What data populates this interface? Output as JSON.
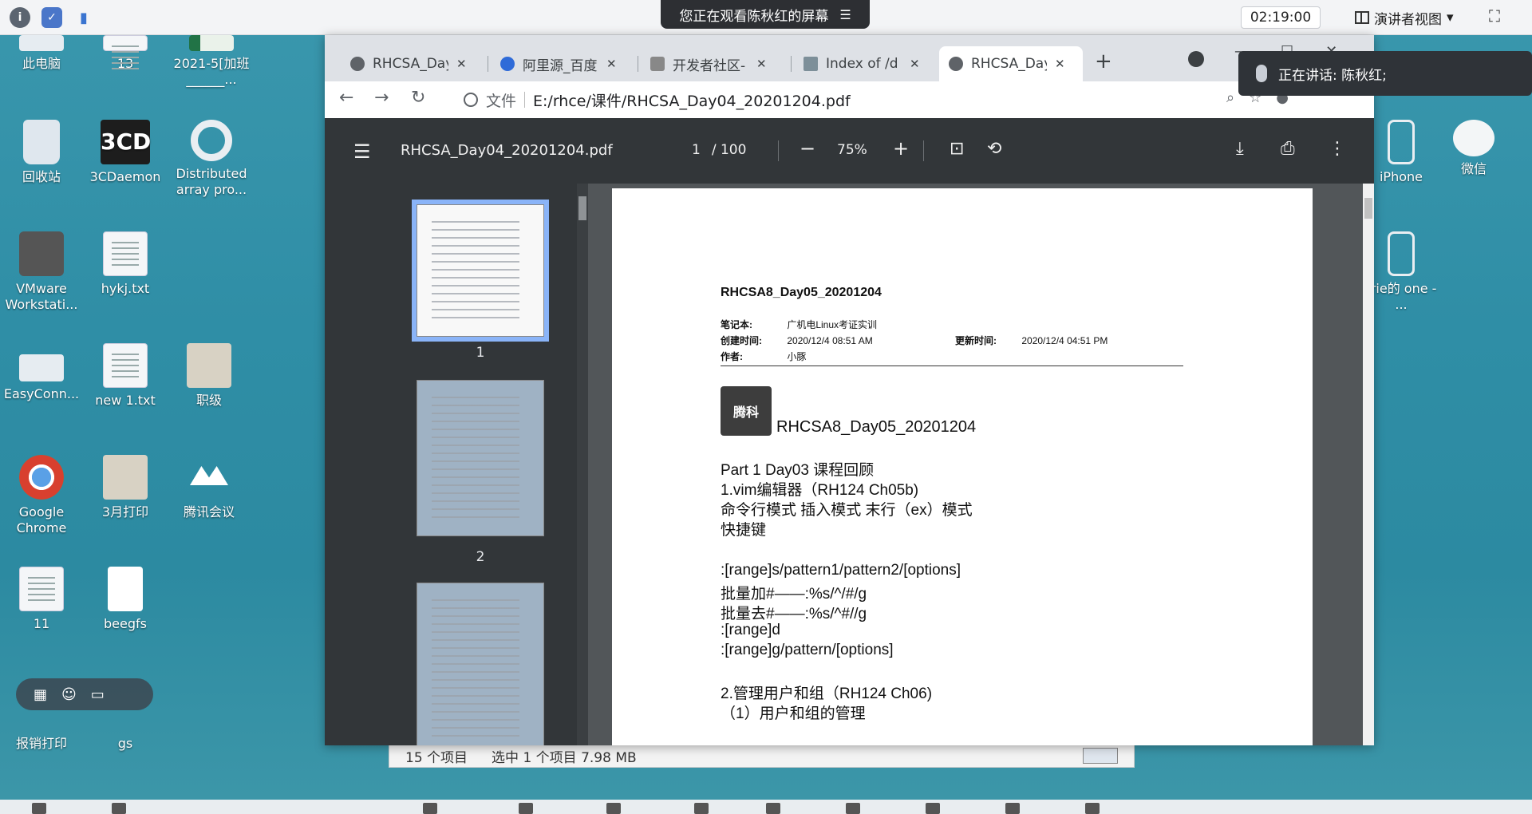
{
  "meeting": {
    "banner": "您正在观看陈秋红的屏幕",
    "time": "02:19:00",
    "view_label": "演讲者视图",
    "speaking": "正在讲话: 陈秋红;"
  },
  "desktop": {
    "icons": [
      {
        "label": "此电脑",
        "icon": "computer-icon"
      },
      {
        "label": "13",
        "icon": "document-icon"
      },
      {
        "label": "2021-5[加班______...",
        "icon": "excel-icon"
      },
      {
        "label": "回收站",
        "icon": "recycle-bin-icon"
      },
      {
        "label": "3CDaemon",
        "icon": "3cd-icon"
      },
      {
        "label": "Distributed array pro...",
        "icon": "ring-icon"
      },
      {
        "label": "VMware Workstati...",
        "icon": "vmware-icon"
      },
      {
        "label": "hykj.txt",
        "icon": "text-file-icon"
      },
      {
        "label": "EasyConn...",
        "icon": "easyconnect-icon"
      },
      {
        "label": "new 1.txt",
        "icon": "text-file-icon"
      },
      {
        "label": "职级",
        "icon": "zip-icon"
      },
      {
        "label": "Google Chrome",
        "icon": "chrome-icon"
      },
      {
        "label": "3月打印",
        "icon": "zip-icon"
      },
      {
        "label": "腾讯会议",
        "icon": "tencent-meeting-icon"
      },
      {
        "label": "11",
        "icon": "document-icon"
      },
      {
        "label": "beegfs",
        "icon": "blank-file-icon"
      },
      {
        "label": "报销打印",
        "icon": "folder-icon"
      },
      {
        "label": "gs",
        "icon": "folder-icon"
      },
      {
        "label": "iPhone",
        "icon": "phone-icon"
      },
      {
        "label": "微信",
        "icon": "wechat-icon"
      },
      {
        "label": "rrie的 one - ...",
        "icon": "phone-icon"
      }
    ]
  },
  "browser": {
    "tabs": [
      {
        "title": "RHCSA_Day",
        "active": false
      },
      {
        "title": "阿里源_百度",
        "active": false
      },
      {
        "title": "开发者社区-",
        "active": false
      },
      {
        "title": "Index of /d",
        "active": false
      },
      {
        "title": "RHCSA_Day",
        "active": true
      }
    ],
    "address_scheme": "文件",
    "address": "E:/rhce/课件/RHCSA_Day04_20201204.pdf"
  },
  "pdf": {
    "filename": "RHCSA_Day04_20201204.pdf",
    "current_page": "1",
    "total_pages": "/ 100",
    "zoom": "75%",
    "thumbnails": [
      "1",
      "2"
    ],
    "page": {
      "title": "RHCSA8_Day05_20201204",
      "notebook_label": "笔记本:",
      "notebook_value": "广机电Linux考证实训",
      "created_label": "创建时间:",
      "created_value": "2020/12/4 08:51 AM",
      "updated_label": "更新时间:",
      "updated_value": "2020/12/4 04:51 PM",
      "author_label": "作者:",
      "author_value": "小豚",
      "logo_text": "腾科",
      "heading": "RHCSA8_Day05_20201204",
      "lines": [
        "Part 1 Day03 课程回顾",
        "1.vim编辑器（RH124 Ch05b)",
        "命令行模式 插入模式 末行（ex）模式",
        "快捷键",
        "",
        ":[range]s/pattern1/pattern2/[options]",
        "批量加#——:%s/^/#/g",
        "批量去#——:%s/^#//g",
        ":[range]d",
        ":[range]g/pattern/[options]",
        "",
        "2.管理用户和组（RH124 Ch06)",
        "（1）用户和组的管理"
      ]
    }
  },
  "explorer": {
    "item_count": "15 个项目",
    "selection": "选中 1 个项目  7.98 MB"
  }
}
